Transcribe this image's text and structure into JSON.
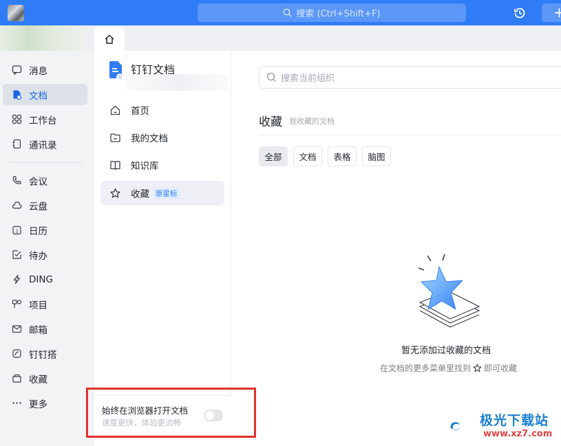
{
  "topbar": {
    "search_placeholder": "搜索 (Ctrl+Shift+F)",
    "add_label": "+"
  },
  "nav": {
    "items": [
      {
        "label": "消息",
        "icon": "message-icon"
      },
      {
        "label": "文档",
        "icon": "document-icon",
        "active": true
      },
      {
        "label": "工作台",
        "icon": "grid-icon"
      },
      {
        "label": "通讯录",
        "icon": "contacts-icon"
      },
      {
        "label": "会议",
        "icon": "phone-icon"
      },
      {
        "label": "云盘",
        "icon": "cloud-icon"
      },
      {
        "label": "日历",
        "icon": "calendar-icon"
      },
      {
        "label": "待办",
        "icon": "todo-icon"
      },
      {
        "label": "DING",
        "icon": "lightning-icon"
      },
      {
        "label": "项目",
        "icon": "project-icon"
      },
      {
        "label": "邮箱",
        "icon": "mail-icon"
      },
      {
        "label": "钉钉搭",
        "icon": "builder-icon"
      },
      {
        "label": "收藏",
        "icon": "collection-icon"
      },
      {
        "label": "更多",
        "icon": "more-icon"
      }
    ]
  },
  "docside": {
    "title": "钉钉文档",
    "items": [
      {
        "label": "首页",
        "icon": "home-icon"
      },
      {
        "label": "我的文档",
        "icon": "folder-icon"
      },
      {
        "label": "知识库",
        "icon": "book-icon"
      },
      {
        "label": "收藏",
        "icon": "star-icon",
        "badge": "原星标",
        "active": true
      }
    ],
    "browser_title": "始终在浏览器打开文档",
    "browser_sub": "速度更快，体验更流畅",
    "browser_toggle_on": false
  },
  "main": {
    "search_placeholder": "搜索当前组织",
    "title": "收藏",
    "subtitle": "我收藏的文档",
    "filters": [
      "全部",
      "文档",
      "表格",
      "脑图"
    ],
    "active_filter": "全部",
    "empty_title": "暂无添加过收藏的文档",
    "empty_hint_before": "在文档的更多菜单里找到",
    "empty_hint_after": "即可收藏"
  },
  "watermark": {
    "text1": "极光下载站",
    "text2": "www.xz7.com"
  },
  "colors": {
    "brand_blue": "#2f7cf6",
    "highlight_red": "#e0312b"
  }
}
